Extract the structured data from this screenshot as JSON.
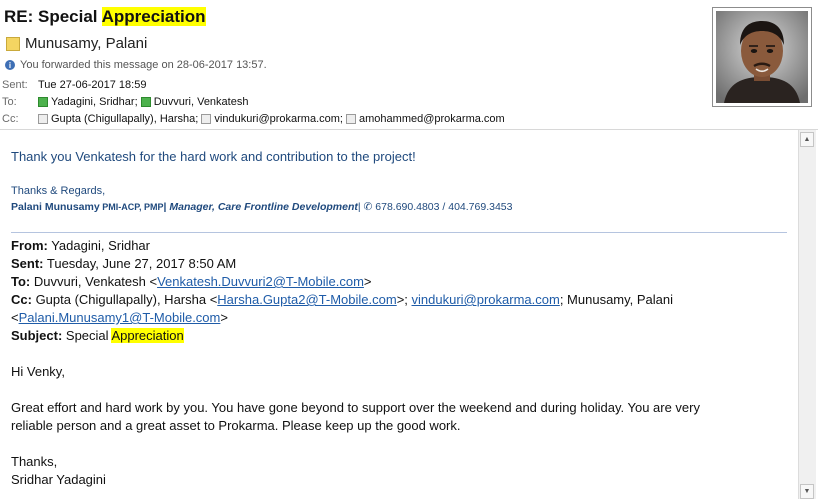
{
  "header": {
    "subject_prefix": "RE: Special ",
    "subject_highlight": "Appreciation",
    "sender": "Munusamy, Palani",
    "info": "You forwarded this message on 28-06-2017 13:57.",
    "sent_label": "Sent:",
    "sent_value": "Tue 27-06-2017 18:59",
    "to_label": "To:",
    "to": [
      "Yadagini, Sridhar;",
      "Duvvuri, Venkatesh"
    ],
    "cc_label": "Cc:",
    "cc": [
      "Gupta (Chigullapally), Harsha;",
      "vindukuri@prokarma.com;",
      "amohammed@prokarma.com"
    ]
  },
  "body": {
    "thank_you": "Thank you Venkatesh for the hard work and contribution to the project!",
    "thanks_regards": "Thanks & Regards,",
    "sig_name": "Palani Munusamy",
    "sig_creds": " PMI-ACP, PMP",
    "sig_bar1": "| ",
    "sig_title": "Manager, Care Frontline Development",
    "sig_bar2": "| ",
    "sig_phone_glyph": "✆",
    "sig_phone": " 678.690.4803 / 404.769.3453"
  },
  "quoted": {
    "from_label": "From:",
    "from_value": " Yadagini, Sridhar",
    "sent_label": "Sent:",
    "sent_value": " Tuesday, June 27, 2017 8:50 AM",
    "to_label": "To:",
    "to_name": " Duvvuri, Venkatesh <",
    "to_email": "Venkatesh.Duvvuri2@T-Mobile.com",
    "to_close": ">",
    "cc_label": "Cc:",
    "cc_name1": " Gupta (Chigullapally), Harsha <",
    "cc_email1": "Harsha.Gupta2@T-Mobile.com",
    "cc_close1": ">; ",
    "cc_email2": "vindukuri@prokarma.com",
    "cc_sep2": "; Munusamy, Palani",
    "cc_open3": "<",
    "cc_email3": "Palani.Munusamy1@T-Mobile.com",
    "cc_close3": ">",
    "subject_label": "Subject:",
    "subject_value": " Special ",
    "subject_highlight": "Appreciation",
    "greeting": "Hi Venky,",
    "para1": "Great effort and hard work by you. You have gone beyond to support over the weekend and during holiday. You are very",
    "para2": "reliable person and a great asset to Prokarma. Please keep up the good work.",
    "closing": "Thanks,",
    "signature": "Sridhar Yadagini"
  },
  "icons": {
    "sender_flag": "contact-card-icon",
    "info": "info-icon",
    "presence": "presence-status-icon",
    "scroll_up": "scroll-up-arrow-icon",
    "scroll_down": "scroll-down-arrow-icon"
  },
  "colors": {
    "highlight": "#ffff00",
    "signature_blue": "#1f497d",
    "link": "#1f5ca8",
    "presence_online": "#4db24d"
  }
}
